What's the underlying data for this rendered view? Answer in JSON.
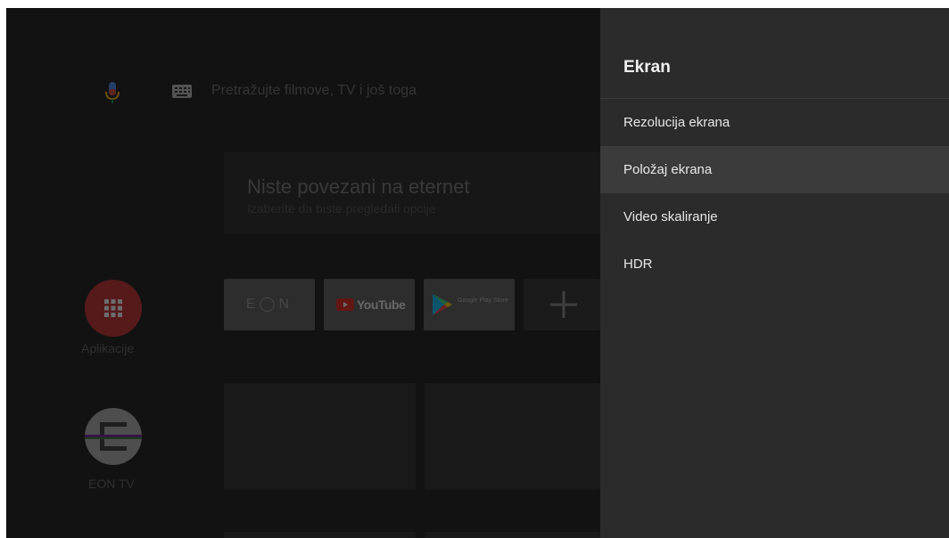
{
  "search": {
    "placeholder_text": "Pretražujte filmove, TV i još toga"
  },
  "banner": {
    "title": "Niste povezani na eternet",
    "subtitle": "Izaberite da biste pregledali opcije"
  },
  "sidebar": {
    "apps_label": "Aplikacije",
    "eon_label": "EON TV"
  },
  "apps_row": {
    "eon_tile_text": "E◯N",
    "youtube_tile_text": "YouTube",
    "play_tile_text": "Google Play Store"
  },
  "settings_panel": {
    "title": "Ekran",
    "items": [
      {
        "label": "Rezolucija ekrana",
        "focused": false
      },
      {
        "label": "Položaj ekrana",
        "focused": true
      },
      {
        "label": "Video skaliranje",
        "focused": false
      },
      {
        "label": "HDR",
        "focused": false
      }
    ]
  },
  "colors": {
    "background": "#121212",
    "panel": "#2b2b2b",
    "focused_item": "#3b3b3b",
    "youtube_red": "#e62117",
    "apps_red": "#c62828"
  },
  "icons": [
    "mic-icon",
    "keyboard-icon",
    "apps-grid-icon",
    "eon-tv-icon",
    "youtube-play-icon",
    "play-store-icon",
    "add-icon"
  ]
}
